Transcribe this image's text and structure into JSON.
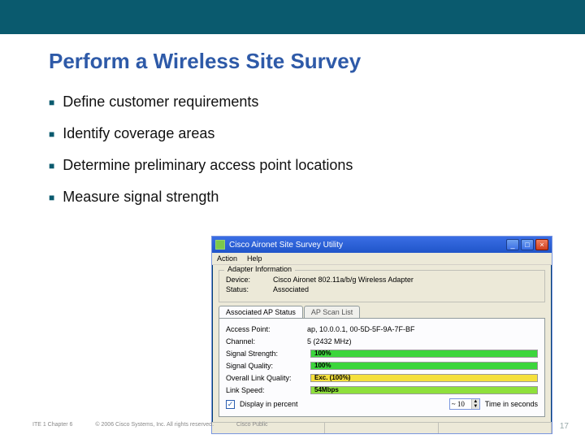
{
  "slide": {
    "title": "Perform a Wireless Site Survey",
    "bullets": [
      "Define customer requirements",
      "Identify coverage areas",
      "Determine preliminary access point locations",
      "Measure signal strength"
    ]
  },
  "footer": {
    "left": "ITE 1 Chapter 6",
    "copyright": "© 2006 Cisco Systems, Inc. All rights reserved.",
    "label": "Cisco Public",
    "page": "17"
  },
  "app": {
    "window_title": "Cisco Aironet Site Survey Utility",
    "menu": {
      "action": "Action",
      "help": "Help"
    },
    "adapter": {
      "panel_title": "Adapter Information",
      "device_label": "Device:",
      "device_value": "Cisco Aironet 802.11a/b/g Wireless Adapter",
      "status_label": "Status:",
      "status_value": "Associated"
    },
    "tabs": {
      "active": "Associated AP Status",
      "inactive": "AP Scan List"
    },
    "rows": {
      "ap": {
        "label": "Access Point:",
        "value": "ap, 10.0.0.1, 00-5D-5F-9A-7F-BF"
      },
      "channel": {
        "label": "Channel:",
        "value": "5 (2432 MHz)"
      },
      "signal_strength": {
        "label": "Signal Strength:",
        "bar_text": "100%",
        "bar_pct": 100,
        "bar_color": "green"
      },
      "signal_quality": {
        "label": "Signal Quality:",
        "bar_text": "100%",
        "bar_pct": 100,
        "bar_color": "green"
      },
      "overall": {
        "label": "Overall Link Quality:",
        "bar_text": "Exc. (100%)",
        "bar_pct": 100,
        "bar_color": "yellow"
      },
      "speed": {
        "label": "Link Speed:",
        "bar_text": "54Mbps",
        "bar_pct": 100,
        "bar_color": "lime"
      }
    },
    "controls": {
      "display_percent_label": "Display in percent",
      "spin_value": "~ 10",
      "time_label": "Time in seconds"
    },
    "btn": {
      "min": "_",
      "max": "□",
      "close": "×"
    }
  }
}
